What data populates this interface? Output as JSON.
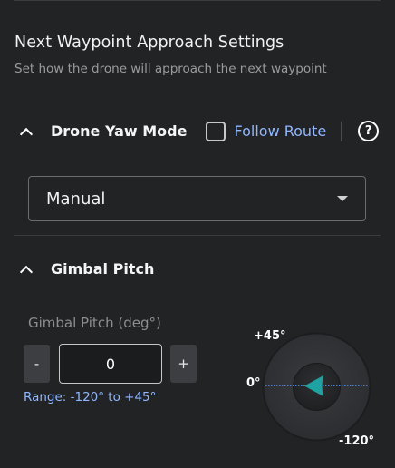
{
  "header": {
    "title": "Next Waypoint Approach Settings",
    "subtitle": "Set how the drone will approach the next waypoint"
  },
  "yaw": {
    "label": "Drone Yaw Mode",
    "follow_route_label": "Follow Route",
    "follow_route_checked": false,
    "help_glyph": "?",
    "mode_value": "Manual"
  },
  "gimbal": {
    "section_label": "Gimbal Pitch",
    "field_label": "Gimbal Pitch (deg°)",
    "minus_label": "-",
    "plus_label": "+",
    "value": "0",
    "range_text": "Range: -120° to +45°",
    "dial": {
      "label_top": "+45°",
      "label_mid": "0°",
      "label_bottom": "-120°",
      "pitch_deg": 0
    }
  },
  "colors": {
    "background": "#222325",
    "accent_blue": "#8fb6ff",
    "indicator_teal": "#1ea3a3"
  },
  "icons": [
    "chevron-up-icon",
    "checkbox",
    "help-icon",
    "caret-down-icon",
    "arrow-left-icon"
  ]
}
